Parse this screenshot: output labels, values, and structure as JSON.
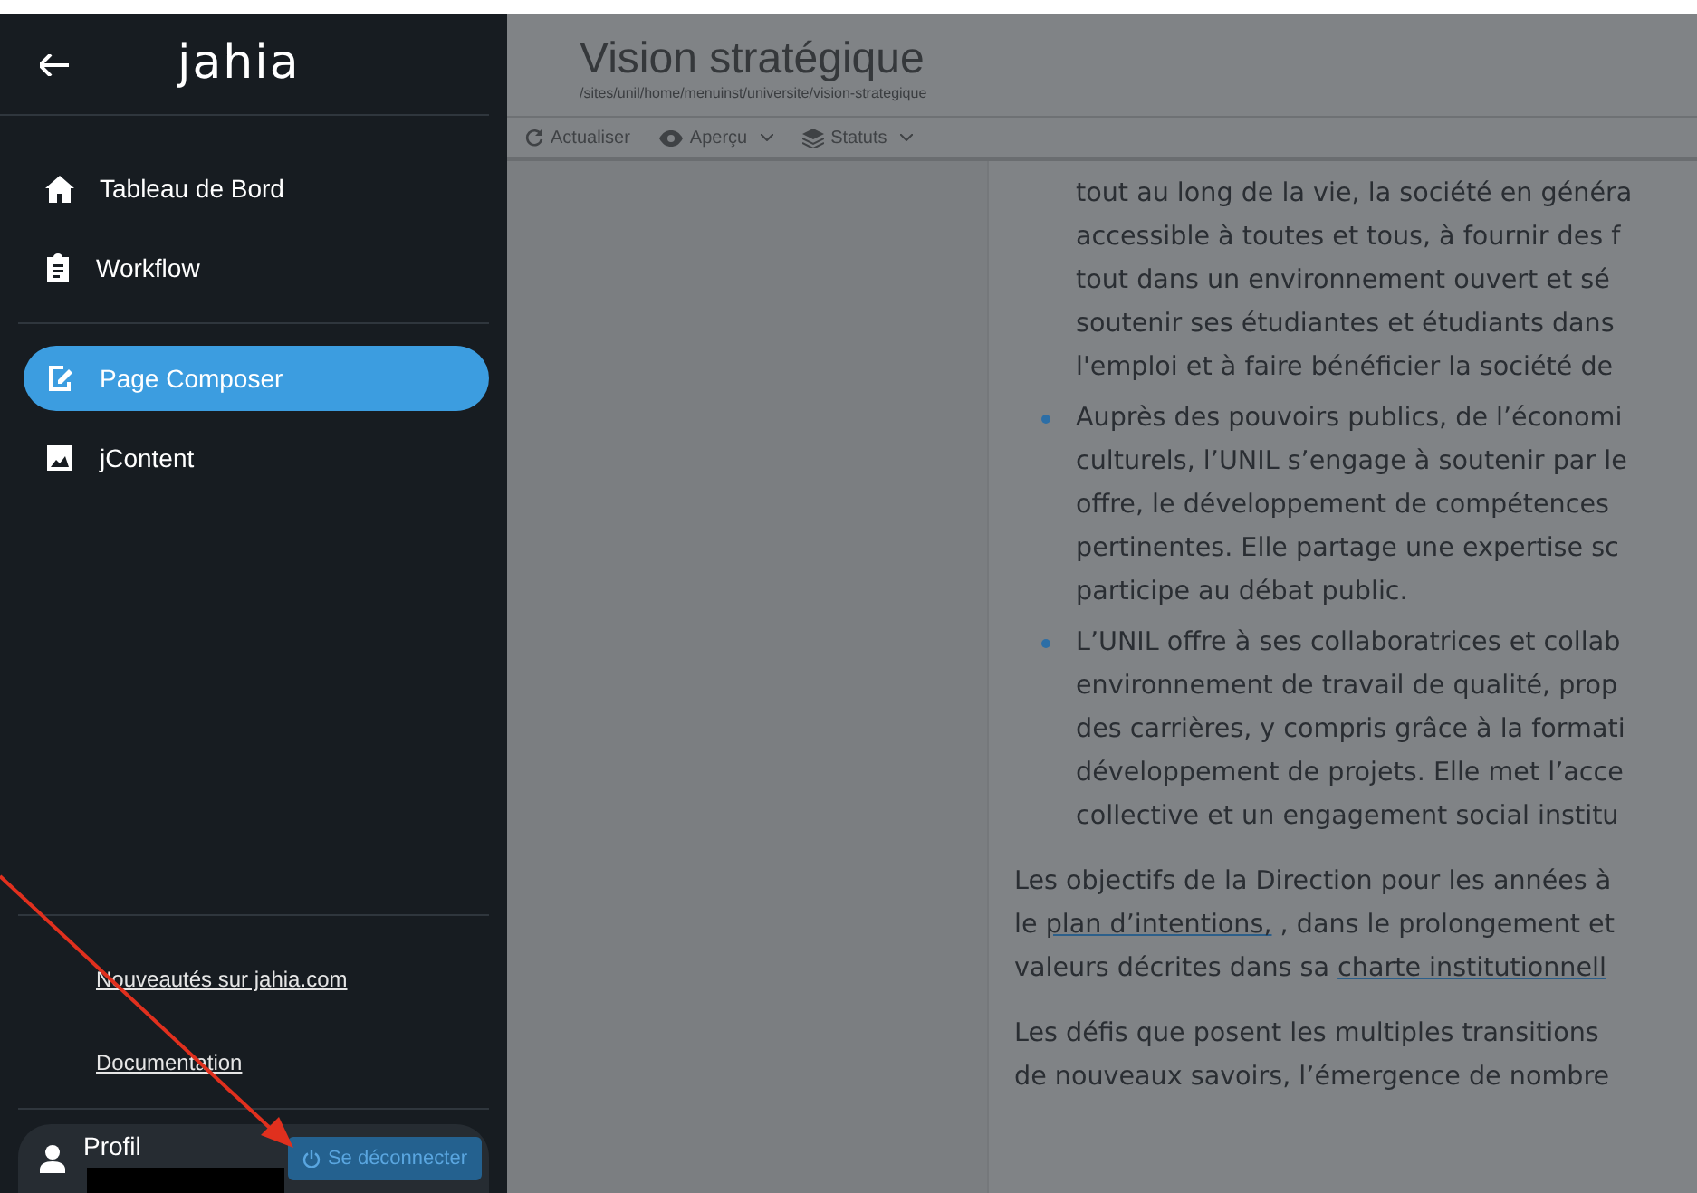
{
  "sidebar": {
    "logo": "jahia",
    "nav": [
      {
        "label": "Tableau de Bord",
        "selected": false
      },
      {
        "label": "Workflow",
        "selected": false
      },
      {
        "label": "Page Composer",
        "selected": true
      },
      {
        "label": "jContent",
        "selected": false
      }
    ],
    "links": [
      "Nouveautés sur jahia.com",
      "Documentation"
    ],
    "profile": {
      "label": "Profil"
    },
    "logout": "Se déconnecter"
  },
  "page": {
    "title": "Vision stratégique",
    "path": "/sites/unil/home/menuinst/universite/vision-strategique",
    "toolbar": [
      {
        "label": "Actualiser",
        "dropdown": false
      },
      {
        "label": "Aperçu",
        "dropdown": true
      },
      {
        "label": "Statuts",
        "dropdown": true
      }
    ],
    "content": [
      {
        "kind": "continuation",
        "lines": [
          [
            {
              "text": "tout au long de la vie, la société en généra",
              "link": false
            }
          ],
          [
            {
              "text": "accessible à toutes et tous, à fournir des f",
              "link": false
            }
          ],
          [
            {
              "text": "tout dans un environnement ouvert et sé",
              "link": false
            }
          ],
          [
            {
              "text": "soutenir ses étudiantes et étudiants dans",
              "link": false
            }
          ],
          [
            {
              "text": "l'emploi et à faire bénéficier la société de",
              "link": false
            }
          ]
        ]
      },
      {
        "kind": "bullet",
        "lines": [
          [
            {
              "text": "Auprès des pouvoirs publics, de l’économi",
              "link": false
            }
          ],
          [
            {
              "text": "culturels, l’UNIL s’engage à soutenir par le",
              "link": false
            }
          ],
          [
            {
              "text": "offre, le développement de compétences",
              "link": false
            }
          ],
          [
            {
              "text": "pertinentes. Elle partage une expertise sc",
              "link": false
            }
          ],
          [
            {
              "text": "participe au débat public.",
              "link": false
            }
          ]
        ]
      },
      {
        "kind": "bullet",
        "lines": [
          [
            {
              "text": "L’UNIL offre à ses collaboratrices et collab",
              "link": false
            }
          ],
          [
            {
              "text": "environnement de travail de qualité, prop",
              "link": false
            }
          ],
          [
            {
              "text": "des carrières, y compris grâce à la formati",
              "link": false
            }
          ],
          [
            {
              "text": "développement de projets. Elle met l’acce",
              "link": false
            }
          ],
          [
            {
              "text": "collective et un engagement social institu",
              "link": false
            }
          ]
        ]
      },
      {
        "kind": "paragraph",
        "lines": [
          [
            {
              "text": "Les objectifs de la Direction pour les années à",
              "link": false
            }
          ],
          [
            {
              "text": "le ",
              "link": false
            },
            {
              "text": "plan d’intentions,",
              "link": true
            },
            {
              "text": " , dans le prolongement et",
              "link": false
            }
          ],
          [
            {
              "text": "valeurs décrites dans sa ",
              "link": false
            },
            {
              "text": "charte institutionnell",
              "link": true
            }
          ]
        ]
      },
      {
        "kind": "paragraph",
        "lines": [
          [
            {
              "text": "Les défis que posent les multiples transitions",
              "link": false
            }
          ],
          [
            {
              "text": "de nouveaux savoirs, l’émergence de nombre",
              "link": false
            }
          ]
        ]
      }
    ]
  }
}
